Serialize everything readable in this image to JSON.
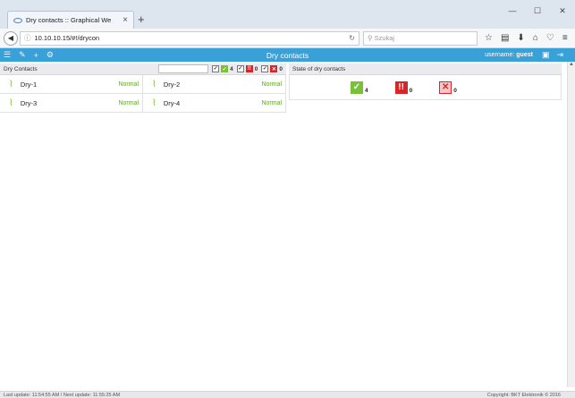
{
  "browser": {
    "tab_title": "Dry contacts :: Graphical We",
    "tab_close": "×",
    "new_tab": "+",
    "win_min": "—",
    "win_max": "☐",
    "win_close": "✕",
    "url": "10.10.10.15/#!/drycon",
    "search_placeholder": "Szukaj"
  },
  "app": {
    "title": "Dry contacts",
    "username_label": "username:",
    "username": "guest"
  },
  "left_panel": {
    "heading": "Dry Contacts",
    "filters": [
      {
        "count": "4",
        "icon": "ok"
      },
      {
        "count": "0",
        "icon": "alarm"
      },
      {
        "count": "0",
        "icon": "error"
      }
    ],
    "contacts": [
      {
        "name": "Dry-1",
        "status": "Normal"
      },
      {
        "name": "Dry-2",
        "status": "Normal"
      },
      {
        "name": "Dry-3",
        "status": "Normal"
      },
      {
        "name": "Dry-4",
        "status": "Normal"
      }
    ]
  },
  "right_panel": {
    "heading": "State of dry contacts",
    "states": [
      {
        "count": "4",
        "icon": "check-icon",
        "color": "#7ac13a"
      },
      {
        "count": "0",
        "icon": "alarm-icon",
        "color": "#d7262a"
      },
      {
        "count": "0",
        "icon": "error-icon",
        "color": "#d7262a"
      }
    ]
  },
  "footer": {
    "left": "Last update: 11:54:55 AM  /  Next update: 11:55:25 AM",
    "right": "Copyright: BKT Elektronik © 2016"
  }
}
